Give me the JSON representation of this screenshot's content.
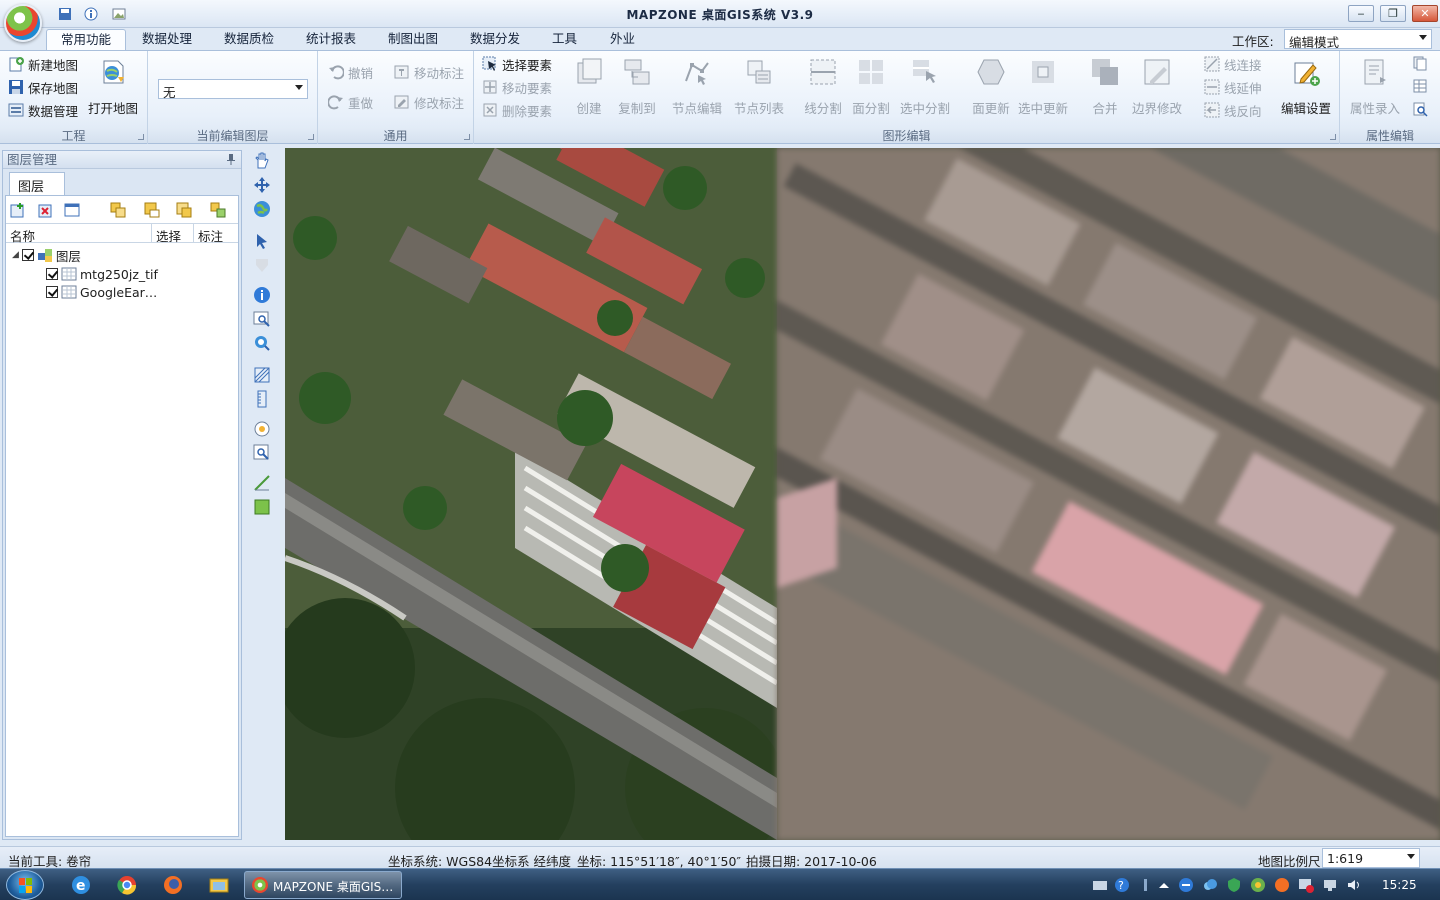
{
  "window": {
    "title": "MAPZONE 桌面GIS系统 V3.9",
    "minimize": "‒",
    "restore": "❐",
    "close": "✕"
  },
  "tabs": [
    "常用功能",
    "数据处理",
    "数据质检",
    "统计报表",
    "制图出图",
    "数据分发",
    "工具",
    "外业"
  ],
  "workspace": {
    "label": "工作区:",
    "value": "编辑模式"
  },
  "ribbon": {
    "project": {
      "title": "工程",
      "new_map": "新建地图",
      "save_map": "保存地图",
      "data_manage": "数据管理",
      "open_map": "打开地图"
    },
    "current_layer": {
      "title": "当前编辑图层",
      "value": "无"
    },
    "general": {
      "title": "通用",
      "undo": "撤销",
      "redo": "重做",
      "move_label": "移动标注",
      "edit_label": "修改标注"
    },
    "geometry": {
      "title": "图形编辑",
      "select": "选择要素",
      "move": "移动要素",
      "delete": "删除要素",
      "create": "创建",
      "copy_to": "复制到",
      "node_edit": "节点编辑",
      "node_list": "节点列表",
      "line_split": "线分割",
      "poly_split": "面分割",
      "selected_split": "选中分割",
      "poly_update": "面更新",
      "selected_update": "选中更新",
      "merge": "合并",
      "boundary_edit": "边界修改",
      "line_connect": "线连接",
      "line_extend": "线延伸",
      "line_reverse": "线反向",
      "edit_settings": "编辑设置"
    },
    "attribute": {
      "title": "属性编辑",
      "attr_input": "属性录入"
    }
  },
  "layer_panel": {
    "header": "图层管理",
    "tab": "图层",
    "columns": [
      "名称",
      "选择",
      "标注"
    ],
    "root": "图层",
    "layers": [
      "mtg250jz_tif",
      "GoogleEar…"
    ]
  },
  "status": {
    "tool": "当前工具: 卷帘",
    "crs": "坐标系统: WGS84坐标系 经纬度",
    "coords": "坐标: 115°51′18″, 40°1′50″",
    "date": "拍摄日期: 2017-10-06",
    "scale_label": "地图比例尺",
    "scale_value": "1:619"
  },
  "taskbar": {
    "app_label": "MAPZONE 桌面GIS…",
    "clock": "15:25"
  },
  "colors": {
    "accent": "#1f6bb5",
    "ribbon_bg": "#e8f0fa",
    "taskbar": "#24405f"
  }
}
